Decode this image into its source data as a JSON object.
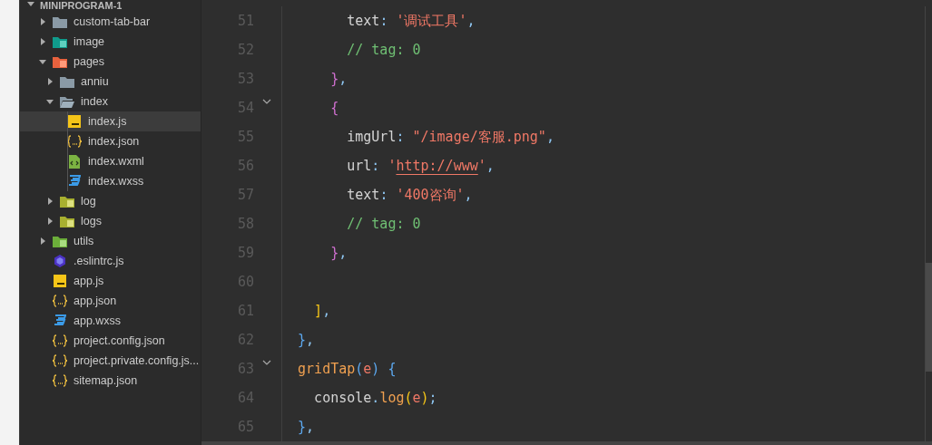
{
  "explorer": {
    "root": {
      "label": "MINIPROGRAM-1",
      "expanded": true
    },
    "items": [
      {
        "label": "custom-tab-bar",
        "kind": "folder",
        "expanded": false,
        "selected": false
      },
      {
        "label": "image",
        "kind": "folder-image",
        "expanded": false,
        "selected": false
      },
      {
        "label": "pages",
        "kind": "folder-pages",
        "expanded": true,
        "selected": false,
        "children": [
          {
            "label": "anniu",
            "kind": "folder",
            "expanded": false,
            "selected": false
          },
          {
            "label": "index",
            "kind": "folder-open",
            "expanded": true,
            "selected": false,
            "children": [
              {
                "label": "index.js",
                "kind": "js",
                "selected": true
              },
              {
                "label": "index.json",
                "kind": "json",
                "selected": false
              },
              {
                "label": "index.wxml",
                "kind": "wxml",
                "selected": false
              },
              {
                "label": "index.wxss",
                "kind": "wxss",
                "selected": false
              }
            ]
          },
          {
            "label": "log",
            "kind": "folder-log",
            "expanded": false,
            "selected": false
          },
          {
            "label": "logs",
            "kind": "folder-log",
            "expanded": false,
            "selected": false
          }
        ]
      },
      {
        "label": "utils",
        "kind": "folder-utils",
        "expanded": false,
        "selected": false
      },
      {
        "label": ".eslintrc.js",
        "kind": "eslint",
        "selected": false
      },
      {
        "label": "app.js",
        "kind": "js",
        "selected": false
      },
      {
        "label": "app.json",
        "kind": "json",
        "selected": false
      },
      {
        "label": "app.wxss",
        "kind": "wxss",
        "selected": false
      },
      {
        "label": "project.config.json",
        "kind": "json",
        "selected": false
      },
      {
        "label": "project.private.config.js...",
        "kind": "json",
        "selected": false
      },
      {
        "label": "sitemap.json",
        "kind": "json",
        "selected": false
      }
    ]
  },
  "editor": {
    "lines": [
      {
        "number": "51",
        "fold": false,
        "tokens": [
          {
            "kind": "plain",
            "text": "        text"
          },
          {
            "kind": "punct",
            "text": ": "
          },
          {
            "kind": "string",
            "text": "'调试工具'"
          },
          {
            "kind": "punct",
            "text": ","
          }
        ]
      },
      {
        "number": "52",
        "fold": false,
        "tokens": [
          {
            "kind": "comment",
            "text": "        // tag: 0"
          }
        ]
      },
      {
        "number": "53",
        "fold": false,
        "tokens": [
          {
            "kind": "brace1",
            "text": "      }"
          },
          {
            "kind": "punct",
            "text": ","
          }
        ]
      },
      {
        "number": "54",
        "fold": true,
        "tokens": [
          {
            "kind": "brace1",
            "text": "      {"
          }
        ]
      },
      {
        "number": "55",
        "fold": false,
        "tokens": [
          {
            "kind": "plain",
            "text": "        imgUrl"
          },
          {
            "kind": "punct",
            "text": ": "
          },
          {
            "kind": "string",
            "text": "\"/image/客服.png\""
          },
          {
            "kind": "punct",
            "text": ","
          }
        ]
      },
      {
        "number": "56",
        "fold": false,
        "tokens": [
          {
            "kind": "plain",
            "text": "        url"
          },
          {
            "kind": "punct",
            "text": ": "
          },
          {
            "kind": "string",
            "text": "'"
          },
          {
            "kind": "link",
            "text": "http://www"
          },
          {
            "kind": "string",
            "text": "'"
          },
          {
            "kind": "punct",
            "text": ","
          }
        ]
      },
      {
        "number": "57",
        "fold": false,
        "tokens": [
          {
            "kind": "plain",
            "text": "        text"
          },
          {
            "kind": "punct",
            "text": ": "
          },
          {
            "kind": "string",
            "text": "'400咨询'"
          },
          {
            "kind": "punct",
            "text": ","
          }
        ]
      },
      {
        "number": "58",
        "fold": false,
        "tokens": [
          {
            "kind": "comment",
            "text": "        // tag: 0"
          }
        ]
      },
      {
        "number": "59",
        "fold": false,
        "tokens": [
          {
            "kind": "brace1",
            "text": "      }"
          },
          {
            "kind": "punct",
            "text": ","
          }
        ]
      },
      {
        "number": "60",
        "fold": false
      },
      {
        "number": "61",
        "fold": false,
        "tokens": [
          {
            "kind": "brace2",
            "text": "    ]"
          },
          {
            "kind": "punct",
            "text": ","
          }
        ]
      },
      {
        "number": "62",
        "fold": false,
        "tokens": [
          {
            "kind": "brace3",
            "text": "  }"
          },
          {
            "kind": "punct",
            "text": ","
          }
        ]
      },
      {
        "number": "63",
        "fold": true,
        "tokens": [
          {
            "kind": "func",
            "text": "  gridTap"
          },
          {
            "kind": "brace3",
            "text": "("
          },
          {
            "kind": "param",
            "text": "e"
          },
          {
            "kind": "brace3",
            "text": ") {"
          }
        ]
      },
      {
        "number": "64",
        "fold": false,
        "tokens": [
          {
            "kind": "plain",
            "text": "    console"
          },
          {
            "kind": "punct",
            "text": "."
          },
          {
            "kind": "func",
            "text": "log"
          },
          {
            "kind": "brace2",
            "text": "("
          },
          {
            "kind": "param",
            "text": "e"
          },
          {
            "kind": "brace2",
            "text": ")"
          },
          {
            "kind": "punct",
            "text": ";"
          }
        ]
      },
      {
        "number": "65",
        "fold": false,
        "tokens": [
          {
            "kind": "brace3",
            "text": "  }"
          },
          {
            "kind": "punct",
            "text": ","
          }
        ]
      }
    ]
  }
}
